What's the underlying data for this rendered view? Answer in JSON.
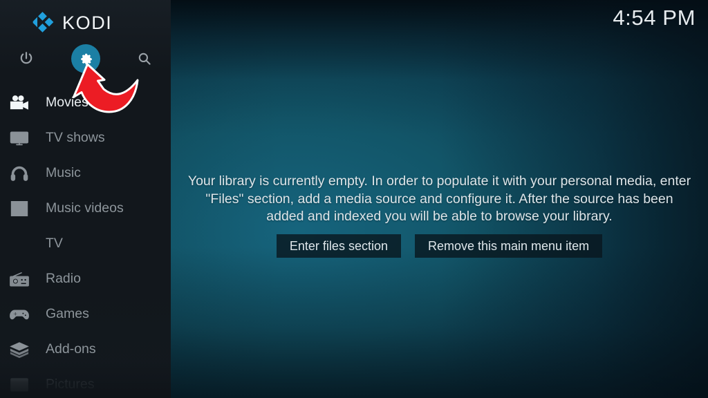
{
  "app": {
    "brand": "KODI",
    "clock": "4:54 PM"
  },
  "toolbar": {
    "power_label": "Power",
    "settings_label": "Settings",
    "search_label": "Search"
  },
  "sidebar": {
    "items": [
      {
        "label": "Movies",
        "icon": "movie-camera-icon",
        "state": "active"
      },
      {
        "label": "TV shows",
        "icon": "television-icon",
        "state": "normal"
      },
      {
        "label": "Music",
        "icon": "headphones-icon",
        "state": "normal"
      },
      {
        "label": "Music videos",
        "icon": "film-note-icon",
        "state": "normal"
      },
      {
        "label": "TV",
        "icon": "tv-antenna-icon",
        "state": "normal"
      },
      {
        "label": "Radio",
        "icon": "radio-icon",
        "state": "normal"
      },
      {
        "label": "Games",
        "icon": "gamepad-icon",
        "state": "normal"
      },
      {
        "label": "Add-ons",
        "icon": "addon-box-icon",
        "state": "normal"
      },
      {
        "label": "Pictures",
        "icon": "picture-icon",
        "state": "dim"
      }
    ]
  },
  "main": {
    "empty_message": "Your library is currently empty. In order to populate it with your personal media, enter \"Files\" section, add a media source and configure it. After the source has been added and indexed you will be able to browse your library.",
    "buttons": [
      {
        "label": "Enter files section"
      },
      {
        "label": "Remove this main menu item"
      }
    ]
  },
  "annotation": {
    "arrow_label": "red-arrow-pointing-to-settings",
    "arrow_color": "#ec1c24",
    "arrow_outline": "#ffffff"
  },
  "colors": {
    "accent_teal": "#1b7fa4",
    "brand_blue": "#21a0dd",
    "sidebar_bg": "#12171c",
    "content_bg": "#125568"
  }
}
